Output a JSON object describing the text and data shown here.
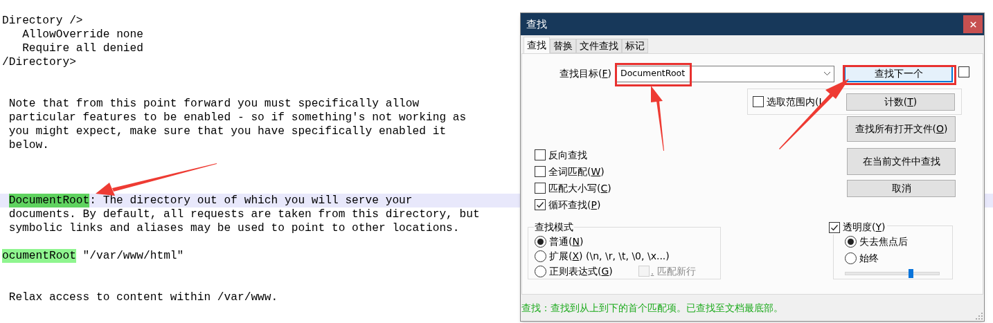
{
  "editor": {
    "lines": [
      {
        "kind": "blank"
      },
      {
        "kind": "code",
        "segments": [
          {
            "text": "Directory />"
          }
        ]
      },
      {
        "kind": "code",
        "segments": [
          {
            "text": "   AllowOverride none"
          }
        ]
      },
      {
        "kind": "code",
        "segments": [
          {
            "text": "   Require all denied"
          }
        ]
      },
      {
        "kind": "code",
        "segments": [
          {
            "text": "/Directory>"
          }
        ]
      },
      {
        "kind": "blank"
      },
      {
        "kind": "blank"
      },
      {
        "kind": "comment",
        "segments": [
          {
            "text": "Note that from this point forward you must specifically allow"
          }
        ]
      },
      {
        "kind": "comment",
        "segments": [
          {
            "text": "particular features to be enabled - so if something's not working as"
          }
        ]
      },
      {
        "kind": "comment",
        "segments": [
          {
            "text": "you might expect, make sure that you have specifically enabled it"
          }
        ]
      },
      {
        "kind": "comment",
        "segments": [
          {
            "text": "below."
          }
        ]
      },
      {
        "kind": "blank"
      },
      {
        "kind": "blank"
      },
      {
        "kind": "blank"
      },
      {
        "kind": "comment",
        "current": true,
        "segments": [
          {
            "text": "DocumentRoot",
            "color": "#5fd35f"
          },
          {
            "text": ": The directory out of which you will serve your"
          }
        ]
      },
      {
        "kind": "comment",
        "segments": [
          {
            "text": "documents. By default, all requests are taken from this directory, but"
          }
        ]
      },
      {
        "kind": "comment",
        "segments": [
          {
            "text": "symbolic links and aliases may be used to point to other locations."
          }
        ]
      },
      {
        "kind": "blank"
      },
      {
        "kind": "code",
        "segments": [
          {
            "text": "ocumentRoot",
            "color": "#8ff58f"
          },
          {
            "text": " \"/var/www/html\""
          }
        ]
      },
      {
        "kind": "blank"
      },
      {
        "kind": "blank"
      },
      {
        "kind": "comment",
        "segments": [
          {
            "text": "Relax access to content within /var/www."
          }
        ]
      }
    ]
  },
  "dialog": {
    "title": "查找",
    "tabs": [
      {
        "label": "查找",
        "selected": true
      },
      {
        "label": "替换",
        "selected": false
      },
      {
        "label": "文件查找",
        "selected": false
      },
      {
        "label": "标记",
        "selected": false
      }
    ],
    "search_field": {
      "label": {
        "text": "查找目标(",
        "key": "F",
        "after": ")"
      },
      "value": "DocumentRoot"
    },
    "find_next_button": "查找下一个",
    "side_checkbox": {
      "checked": false
    },
    "in_selection": {
      "label": {
        "text": "选取范围内(",
        "key": "I"
      },
      "checked": false
    },
    "buttons": [
      {
        "label": {
          "text": "计数(",
          "key": "T",
          "after": ")"
        }
      },
      {
        "label": {
          "text": "查找所有打开文件(",
          "key": "O",
          "after": ")"
        }
      },
      {
        "label": {
          "text": "在当前文件中查找"
        }
      },
      {
        "label": {
          "text": "取消"
        }
      }
    ],
    "options": [
      {
        "label": {
          "text": "反向查找"
        },
        "checked": false
      },
      {
        "label": {
          "text": "全词匹配(",
          "key": "W",
          "after": ")"
        },
        "checked": false
      },
      {
        "label": {
          "text": "匹配大小写(",
          "key": "C",
          "after": ")"
        },
        "checked": false
      },
      {
        "label": {
          "text": "循环查找(",
          "key": "P",
          "after": ")"
        },
        "checked": true
      }
    ],
    "search_mode": {
      "title": "查找模式",
      "modes": [
        {
          "label": {
            "text": "普通(",
            "key": "N",
            "after": ")"
          },
          "selected": true
        },
        {
          "label": {
            "text": "扩展(",
            "key": "X",
            "after": ") (\\n, \\r, \\t, \\0, \\x...)"
          },
          "selected": false
        },
        {
          "label": {
            "text": "正则表达式(",
            "key": "G",
            "after": ")"
          },
          "selected": false
        }
      ],
      "dot_newline": {
        "label": {
          "key": ".",
          "after": " 匹配新行"
        },
        "checked": false,
        "disabled": true
      }
    },
    "transparency": {
      "label": {
        "text": "透明度(",
        "key": "Y",
        "after": ")"
      },
      "checked": true,
      "modes": [
        {
          "label": {
            "text": "失去焦点后"
          },
          "selected": true
        },
        {
          "label": {
            "text": "始终"
          },
          "selected": false
        }
      ],
      "level": 0.7
    },
    "status": "查找：查找到从上到下的首个匹配项。已查找至文档最底部。"
  }
}
